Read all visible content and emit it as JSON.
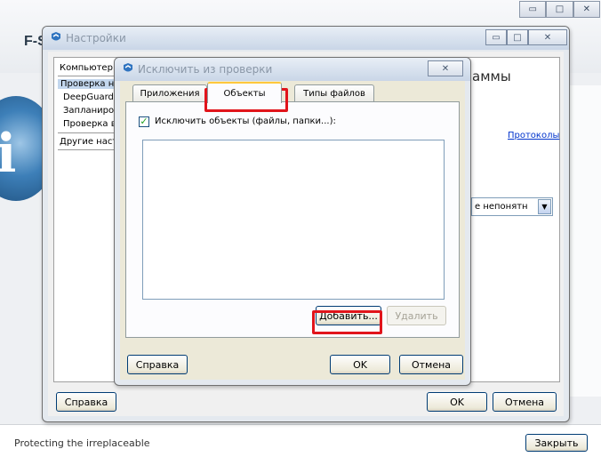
{
  "app": {
    "logo_text": "F-S",
    "tagline": "Protecting the irreplaceable",
    "close_button": "Закрыть",
    "window_controls": [
      "▭",
      "□",
      "✕"
    ]
  },
  "settings": {
    "title": "Настройки",
    "nav": {
      "header": "Компьютер",
      "items": [
        "Проверка н",
        "DeepGuard",
        "Запланиров",
        "Проверка в"
      ],
      "other": "Другие настр"
    },
    "right_heading": "аммы",
    "protocols_link": "Протоколы",
    "combo_value": "е непонятн",
    "help_button": "Справка",
    "ok_button": "OK",
    "cancel_button": "Отмена"
  },
  "dialog": {
    "title": "Исключить из проверки",
    "tabs": [
      "Приложения",
      "Объекты",
      "Типы файлов"
    ],
    "active_tab": "Объекты",
    "checkbox_label": "Исключить объекты (файлы, папки...):",
    "checkbox_checked": true,
    "list_items": [],
    "add_button": "Добавить...",
    "remove_button": "Удалить",
    "help_button": "Справка",
    "ok_button": "OK",
    "cancel_button": "Отмена"
  },
  "colors": {
    "highlight": "#e1141b",
    "link": "#0033cc",
    "title_text": "#8a97a7"
  }
}
